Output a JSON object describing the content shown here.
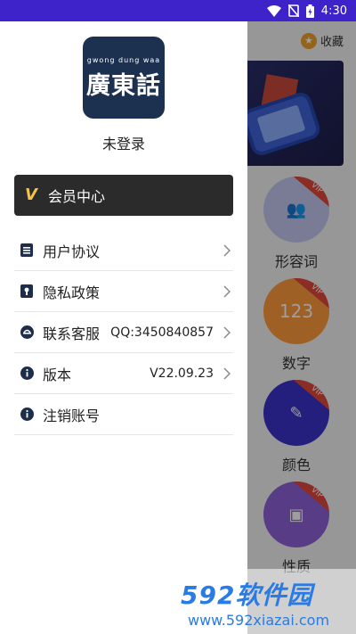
{
  "status_bar": {
    "time": "4:30",
    "icons": [
      "wifi-icon",
      "no-sim-icon",
      "battery-icon"
    ]
  },
  "background_app": {
    "favorites_label": "收藏",
    "categories": [
      {
        "label": "形容词",
        "badge": "VIP",
        "color": "#c6c9f2"
      },
      {
        "label": "数字",
        "badge": "VIP",
        "color": "#ff9b3c"
      },
      {
        "label": "颜色",
        "badge": "VIP",
        "color": "#3a32c8"
      },
      {
        "label": "性质",
        "badge": "VIP",
        "color": "#8f62d8"
      }
    ],
    "number_icon_text": "123"
  },
  "drawer": {
    "logo": {
      "subtitle": "gwong dung waa",
      "title": "廣東話"
    },
    "username": "未登录",
    "member_center": {
      "label": "会员中心",
      "accent": "#f3c247"
    },
    "menu": [
      {
        "label": "用户协议",
        "value": "",
        "icon": "document-icon"
      },
      {
        "label": "隐私政策",
        "value": "",
        "icon": "lock-icon"
      },
      {
        "label": "联系客服",
        "value": "QQ:3450840857",
        "icon": "service-icon"
      },
      {
        "label": "版本",
        "value": "V22.09.23",
        "icon": "info-icon"
      },
      {
        "label": "注销账号",
        "value": "",
        "icon": "info-icon"
      }
    ]
  },
  "watermark": {
    "brand": "592软件园",
    "url": "www.592xiazai.com"
  }
}
